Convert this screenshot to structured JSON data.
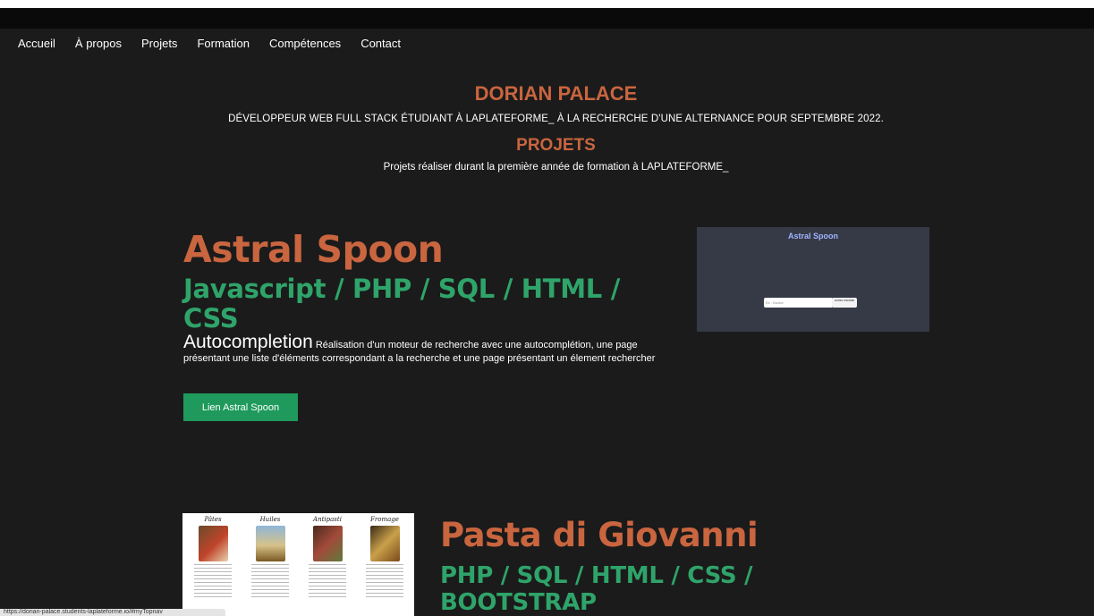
{
  "nav": {
    "items": [
      {
        "label": "Accueil"
      },
      {
        "label": "À propos"
      },
      {
        "label": "Projets"
      },
      {
        "label": "Formation"
      },
      {
        "label": "Compétences"
      },
      {
        "label": "Contact"
      }
    ]
  },
  "hero": {
    "name": "DORIAN PALACE",
    "subtitle": "DÉVELOPPEUR WEB FULL STACK ÉTUDIANT À LAPLATEFORME_ À LA RECHERCHE D'UNE ALTERNANCE POUR SEPTEMBRE 2022."
  },
  "projects_section": {
    "title": "PROJETS",
    "subtitle": "Projets réaliser durant la première année de formation à LAPLATEFORME_"
  },
  "project1": {
    "title": "Astral Spoon",
    "tech": "Javascript / PHP / SQL / HTML / CSS",
    "desc_lead": "Autocompletion",
    "desc": "Réalisation d'un moteur de recherche avec une autocomplétion, une page présentant une liste d'éléments correspondant a la recherche et une page présentant un élement rechercher",
    "button": "Lien Astral Spoon",
    "thumbnail": {
      "title": "Astral Spoon",
      "input_placeholder": "Ex : Doctor",
      "button": "Autres résultats"
    }
  },
  "project2": {
    "title": "Pasta di Giovanni",
    "tech": "PHP / SQL / HTML / CSS / BOOTSTRAP",
    "thumbnail": {
      "columns": [
        "Pâtes",
        "Huiles",
        "Antipasti",
        "Fromage"
      ]
    }
  },
  "status_url": "https://dorian-palace.students-laplateforme.io/#myTopnav",
  "colors": {
    "background": "#1b1b1b",
    "accent_orange": "#c9653f",
    "accent_green": "#2fa46a",
    "button_green": "#1f9a5c"
  }
}
